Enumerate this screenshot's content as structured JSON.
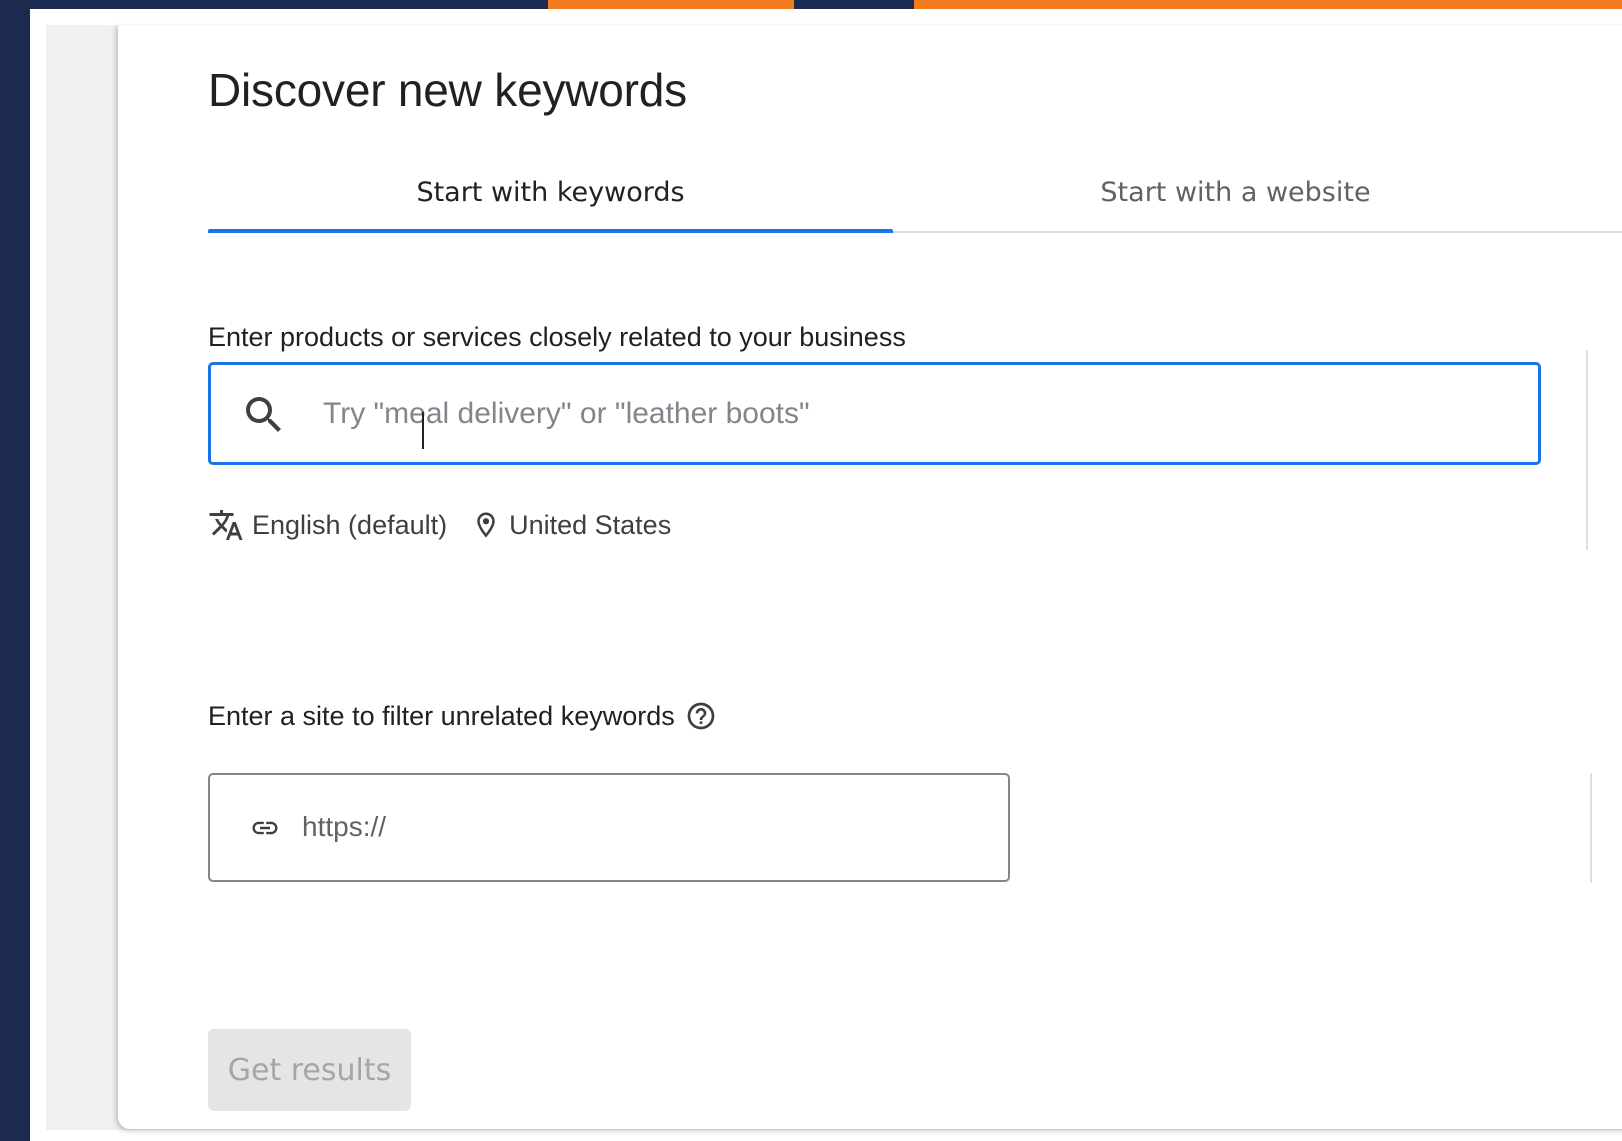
{
  "page": {
    "title": "Discover new keywords"
  },
  "tabs": [
    {
      "label": "Start with keywords",
      "active": true
    },
    {
      "label": "Start with a website",
      "active": false
    }
  ],
  "keyword_section": {
    "label": "Enter products or services closely related to your business",
    "placeholder": "Try \"meal delivery\" or \"leather boots\"",
    "value": ""
  },
  "settings": {
    "language": "English (default)",
    "location": "United States"
  },
  "site_filter": {
    "label": "Enter a site to filter unrelated keywords",
    "placeholder": "https://",
    "value": ""
  },
  "actions": {
    "get_results_label": "Get results",
    "get_results_enabled": false
  },
  "icons": {
    "search": "search-icon",
    "language": "translate-icon",
    "location": "location-pin-icon",
    "help": "help-circle-icon",
    "link": "link-icon"
  },
  "colors": {
    "accent": "#1a73e8",
    "frame_navy": "#1b2a4e",
    "frame_orange": "#f47b20",
    "disabled_button_bg": "#e5e5e5",
    "disabled_button_text": "#a4a6a9"
  }
}
